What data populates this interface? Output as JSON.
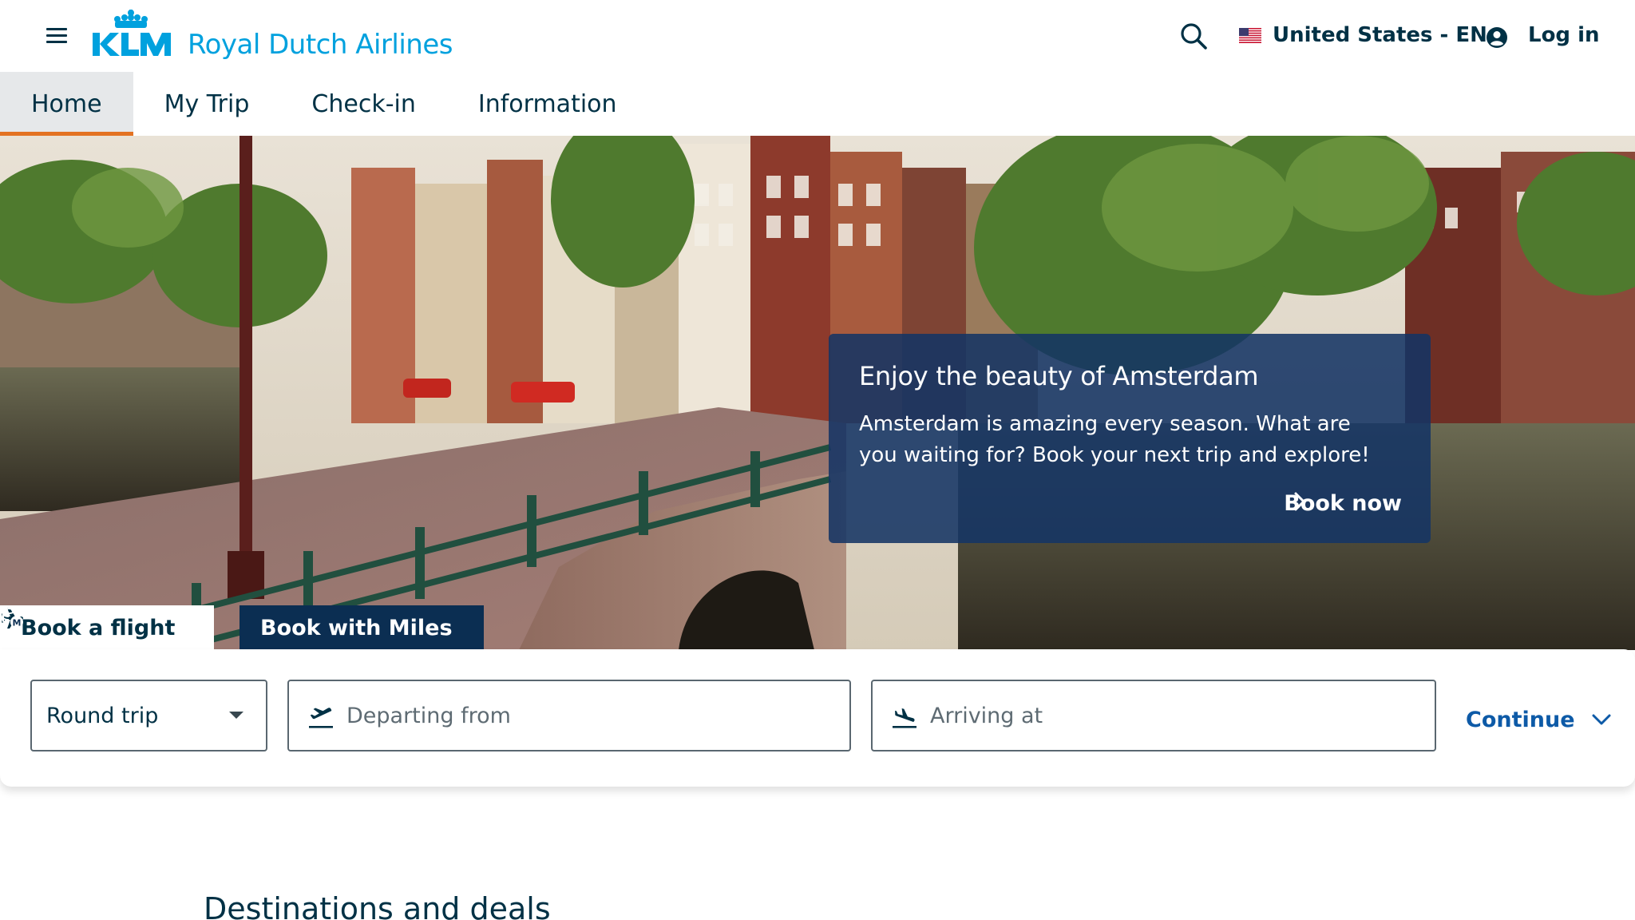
{
  "header": {
    "brand": "KLM",
    "tagline": "Royal Dutch Airlines",
    "locale_label": "United States - EN",
    "login_label": "Log in"
  },
  "nav": {
    "tabs": [
      {
        "label": "Home",
        "active": true
      },
      {
        "label": "My Trip",
        "active": false
      },
      {
        "label": "Check-in",
        "active": false
      },
      {
        "label": "Information",
        "active": false
      }
    ]
  },
  "hero": {
    "promo_title": "Enjoy the beauty of Amsterdam",
    "promo_text": "Amsterdam is amazing every season. What are you waiting for? Book your next trip and explore!",
    "promo_cta": "Book now"
  },
  "booking": {
    "tabs": [
      {
        "label": "Book a flight",
        "icon": "airplane-icon",
        "active": true
      },
      {
        "label": "Book with Miles",
        "icon": "miles-icon",
        "active": false
      }
    ],
    "trip_type": "Round trip",
    "departing_placeholder": "Departing from",
    "arriving_placeholder": "Arriving at",
    "continue_label": "Continue"
  },
  "sections": {
    "destinations_heading": "Destinations and deals"
  },
  "colors": {
    "brand_blue": "#00a1de",
    "navy": "#003145",
    "nav_active_underline": "#e37222",
    "link_blue": "#0d5aa7",
    "promo_card": "#143464"
  }
}
